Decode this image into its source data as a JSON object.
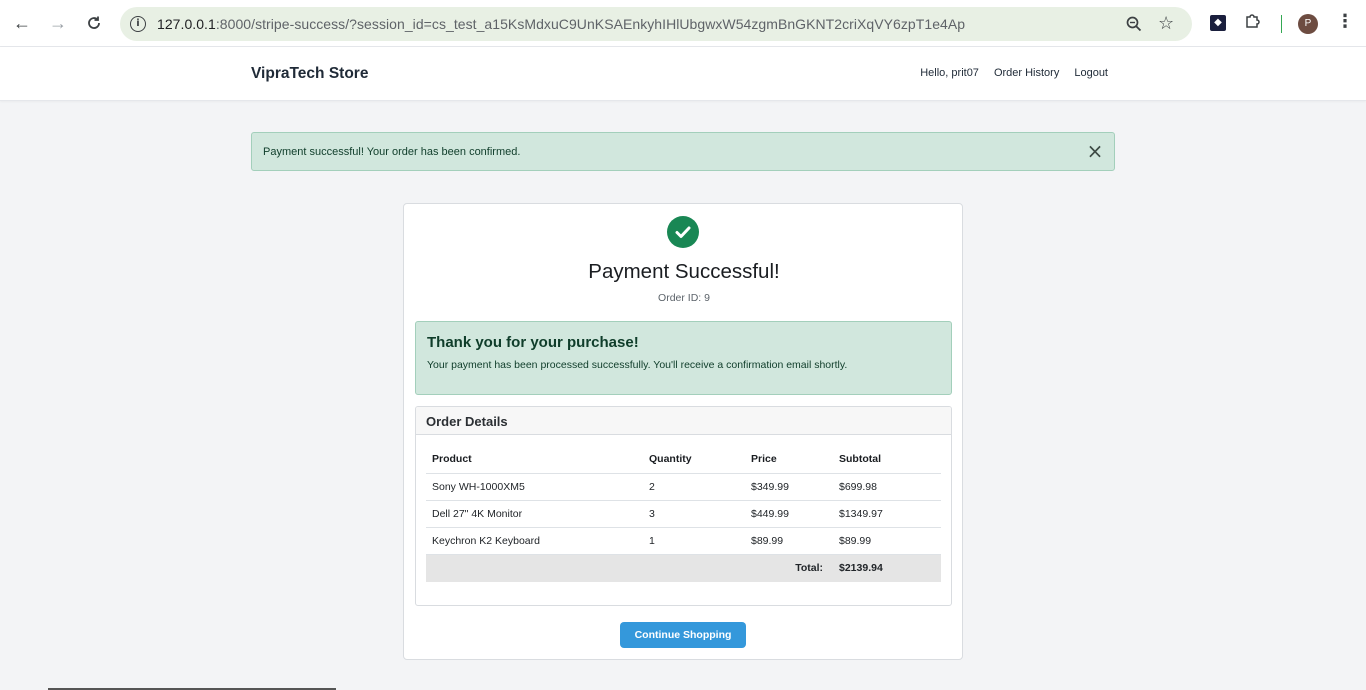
{
  "browser": {
    "url_host": "127.0.0.1",
    "url_path": ":8000/stripe-success/?session_id=cs_test_a15KsMdxuC9UnKSAEnkyhIHlUbgwxW54zgmBnGKNT2criXqVY6zpT1e4Ap",
    "profile_initial": "P"
  },
  "navbar": {
    "brand": "VipraTech Store",
    "greeting": "Hello, prit07",
    "order_history": "Order History",
    "logout": "Logout"
  },
  "alert": {
    "message": "Payment successful! Your order has been confirmed.",
    "close": "×"
  },
  "card": {
    "title": "Payment Successful!",
    "order_id": "Order ID: 9",
    "thanks_heading": "Thank you for your purchase!",
    "thanks_text": "Your payment has been processed successfully. You'll receive a confirmation email shortly.",
    "details_heading": "Order Details",
    "table": {
      "headers": [
        "Product",
        "Quantity",
        "Price",
        "Subtotal"
      ],
      "rows": [
        [
          "Sony WH-1000XM5",
          "2",
          "$349.99",
          "$699.98"
        ],
        [
          "Dell 27\" 4K Monitor",
          "3",
          "$449.99",
          "$1349.97"
        ],
        [
          "Keychron K2 Keyboard",
          "1",
          "$89.99",
          "$89.99"
        ]
      ],
      "total_label": "Total:",
      "total_value": "$2139.94"
    },
    "button": "Continue Shopping"
  },
  "colors": {
    "success_bg": "#d1e7dd",
    "success_icon": "#198754",
    "primary_button": "#3498db"
  }
}
